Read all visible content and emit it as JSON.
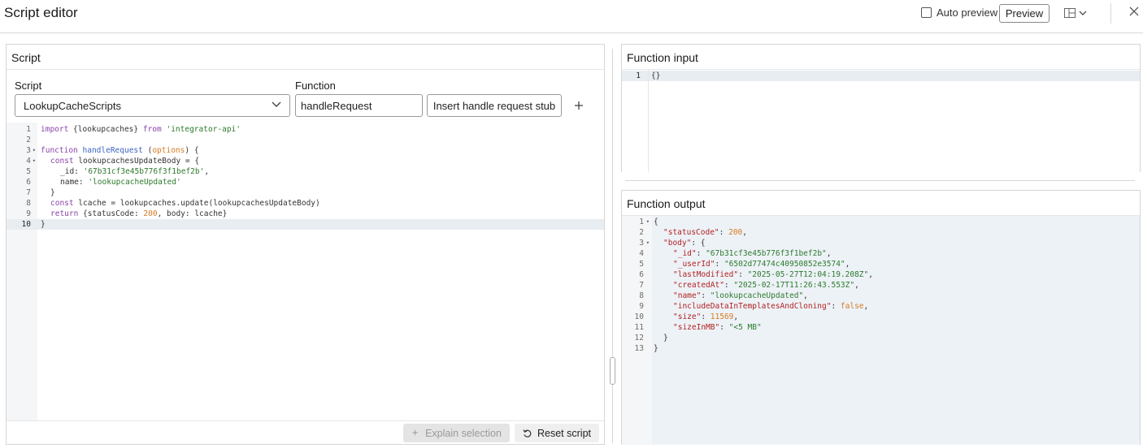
{
  "header": {
    "title": "Script editor",
    "auto_preview_label": "Auto preview",
    "auto_preview_checked": false,
    "preview_label": "Preview"
  },
  "script_panel": {
    "heading": "Script",
    "script_label": "Script",
    "script_selected": "LookupCacheScripts",
    "function_label": "Function",
    "function_value": "handleRequest",
    "stub_button": "Insert handle request stub",
    "explain_button": "Explain selection",
    "reset_button": "Reset script",
    "line_numbers": [
      "1",
      "2",
      "3",
      "4",
      "5",
      "6",
      "7",
      "8",
      "9",
      "10"
    ]
  },
  "input_panel": {
    "heading": "Function input",
    "line_numbers": [
      "1"
    ],
    "code": "{}"
  },
  "output_panel": {
    "heading": "Function output",
    "line_numbers": [
      "1",
      "2",
      "3",
      "4",
      "5",
      "6",
      "7",
      "8",
      "9",
      "10",
      "11",
      "12",
      "13"
    ]
  },
  "script_code": {
    "import_kw": "import",
    "import_names": " {lookupcaches} ",
    "from_kw": "from",
    "import_src": "'integrator-api'",
    "function_kw": "function",
    "fn_name": "handleRequest",
    "param": "options",
    "const_kw": "const",
    "body_var": " lookupcachesUpdateBody = {",
    "id_key": "_id: ",
    "id_val": "'67b31cf3e45b776f3f1bef2b'",
    "name_key": "name: ",
    "name_val": "'lookupcacheUpdated'",
    "close_brace": "}",
    "lcache_line": " lcache = lookupcaches.update(lookupcachesUpdateBody)",
    "return_kw": "return",
    "return_a": " {statusCode: ",
    "status_num": "200",
    "return_b": ", body: lcache}",
    "fn_close": "}"
  },
  "output_code": {
    "open": "{",
    "k_status": "\"statusCode\"",
    "v_status": "200",
    "k_body": "\"body\"",
    "k_id": "\"_id\"",
    "v_id": "\"67b31cf3e45b776f3f1bef2b\"",
    "k_user": "\"_userId\"",
    "v_user": "\"6502d77474c40950852e3574\"",
    "k_lastmod": "\"lastModified\"",
    "v_lastmod": "\"2025-05-27T12:04:19.208Z\"",
    "k_created": "\"createdAt\"",
    "v_created": "\"2025-02-17T11:26:43.553Z\"",
    "k_name": "\"name\"",
    "v_name": "\"lookupcacheUpdated\"",
    "k_include": "\"includeDataInTemplatesAndCloning\"",
    "v_include": "false",
    "k_size": "\"size\"",
    "v_size": "11569",
    "k_sizemb": "\"sizeInMB\"",
    "v_sizemb": "\"<5 MB\"",
    "body_close": "}",
    "close": "}"
  },
  "icons": {
    "layout": "layout-icon",
    "close": "close-icon",
    "chevron": "chevron-down-icon",
    "plus": "plus-icon",
    "sparkle": "sparkle-icon",
    "reset": "reset-icon"
  }
}
